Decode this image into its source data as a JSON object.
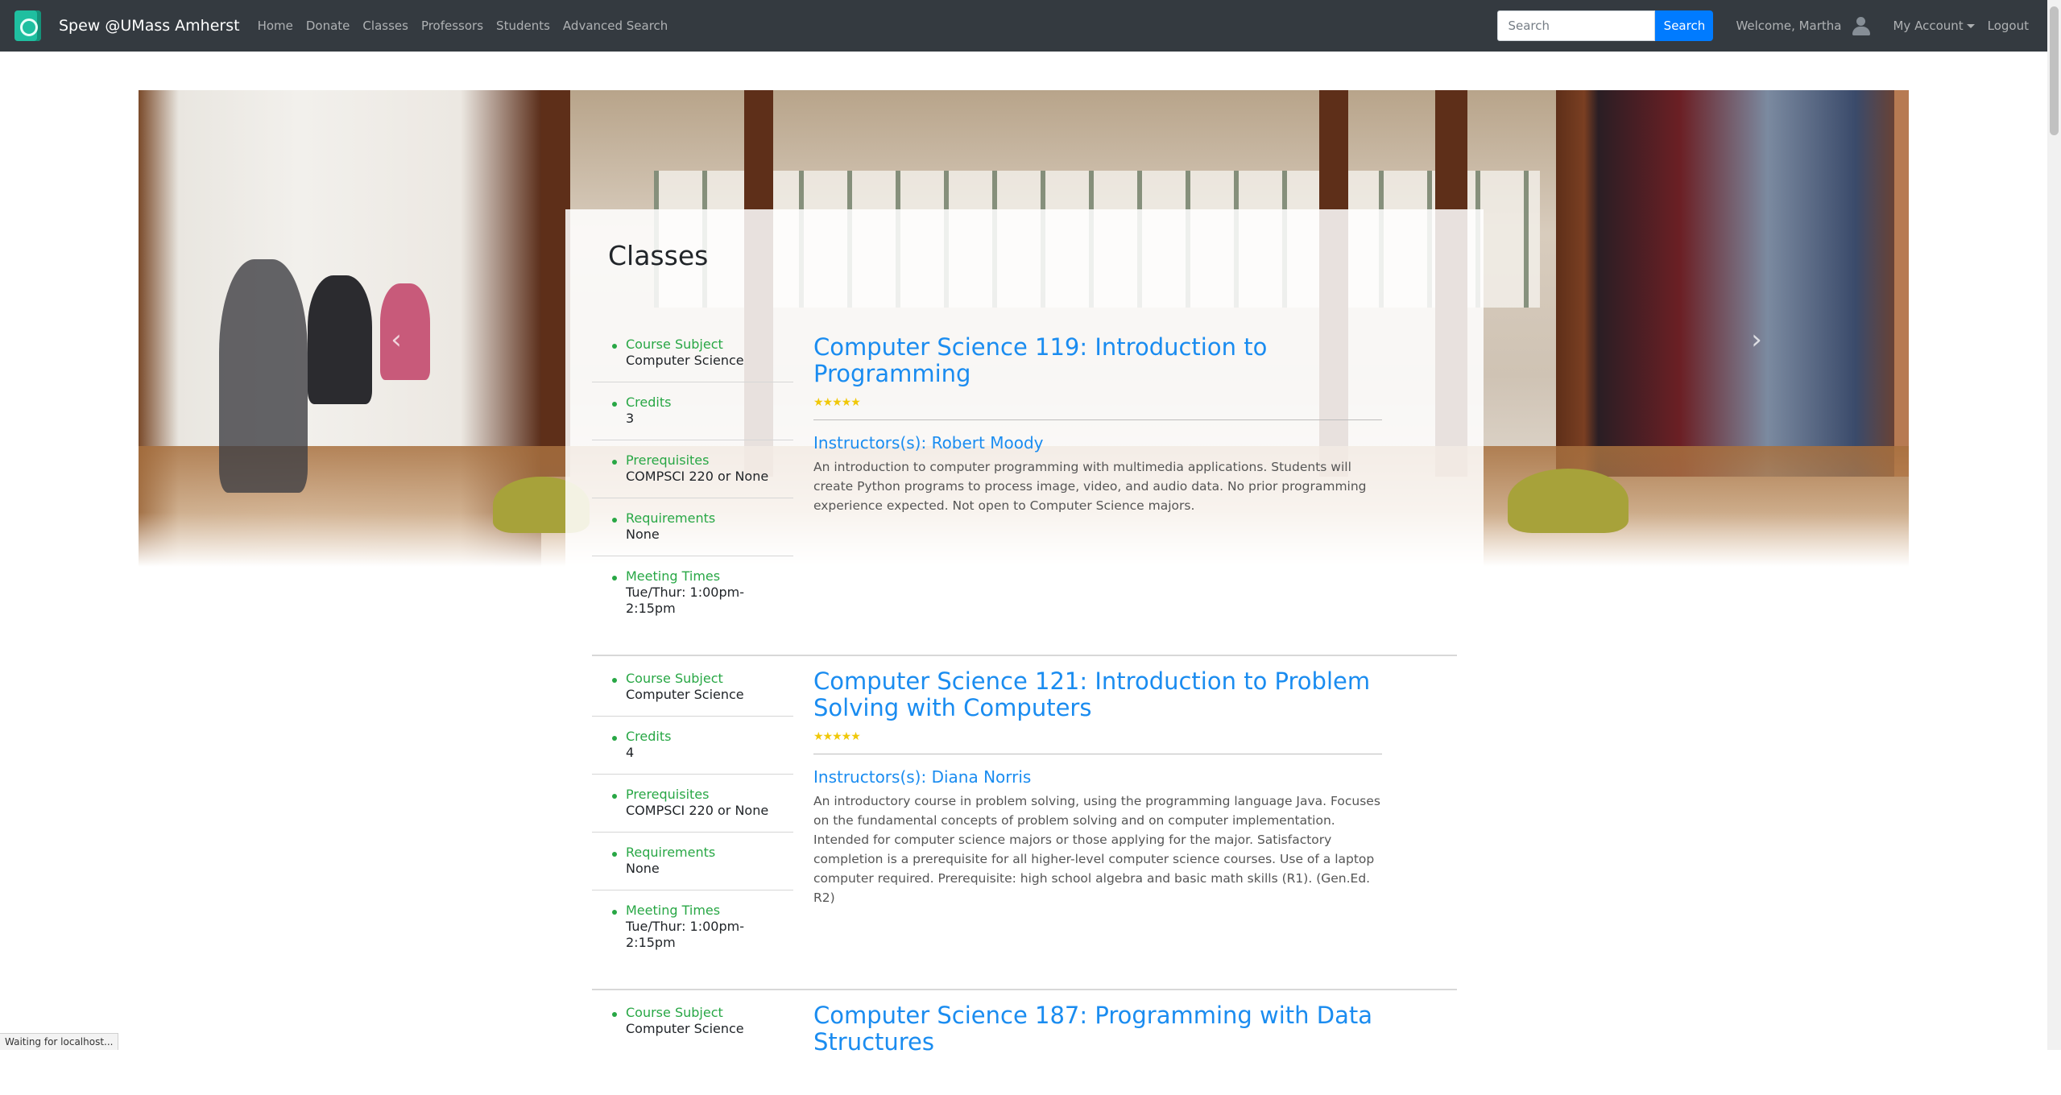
{
  "navbar": {
    "brand": "Spew @UMass Amherst",
    "links": [
      "Home",
      "Donate",
      "Classes",
      "Professors",
      "Students",
      "Advanced Search"
    ],
    "search_placeholder": "Search",
    "search_button": "Search",
    "welcome": "Welcome, Martha",
    "account": "My Account",
    "logout": "Logout"
  },
  "page": {
    "title": "Classes"
  },
  "labels": {
    "subject": "Course Subject",
    "credits": "Credits",
    "prerequisites": "Prerequisites",
    "requirements": "Requirements",
    "meeting": "Meeting Times",
    "or": "or"
  },
  "classes": [
    {
      "subject": "Computer Science",
      "credits": "3",
      "prereq_course": "COMPSCI 220",
      "prereq_alt": "None",
      "requirements": "None",
      "meeting": "Tue/Thur: 1:00pm-2:15pm",
      "title": "Computer Science 119: Introduction to Programming",
      "rating": 5,
      "instructors": "Instructors(s): Robert Moody",
      "description": "An introduction to computer programming with multimedia applications. Students will create Python programs to process image, video, and audio data. No prior programming experience expected. Not open to Computer Science majors."
    },
    {
      "subject": "Computer Science",
      "credits": "4",
      "prereq_course": "COMPSCI 220",
      "prereq_alt": "None",
      "requirements": "None",
      "meeting": "Tue/Thur: 1:00pm-2:15pm",
      "title": "Computer Science 121: Introduction to Problem Solving with Computers",
      "rating": 5,
      "instructors": "Instructors(s): Diana Norris",
      "description": "An introductory course in problem solving, using the programming language Java. Focuses on the fundamental concepts of problem solving and on computer implementation. Intended for computer science majors or those applying for the major. Satisfactory completion is a prerequisite for all higher-level computer science courses. Use of a laptop computer required. Prerequisite: high school algebra and basic math skills (R1). (Gen.Ed. R2)"
    },
    {
      "subject": "Computer Science",
      "title": "Computer Science 187: Programming with Data Structures"
    }
  ],
  "status_bar": "Waiting for localhost..."
}
